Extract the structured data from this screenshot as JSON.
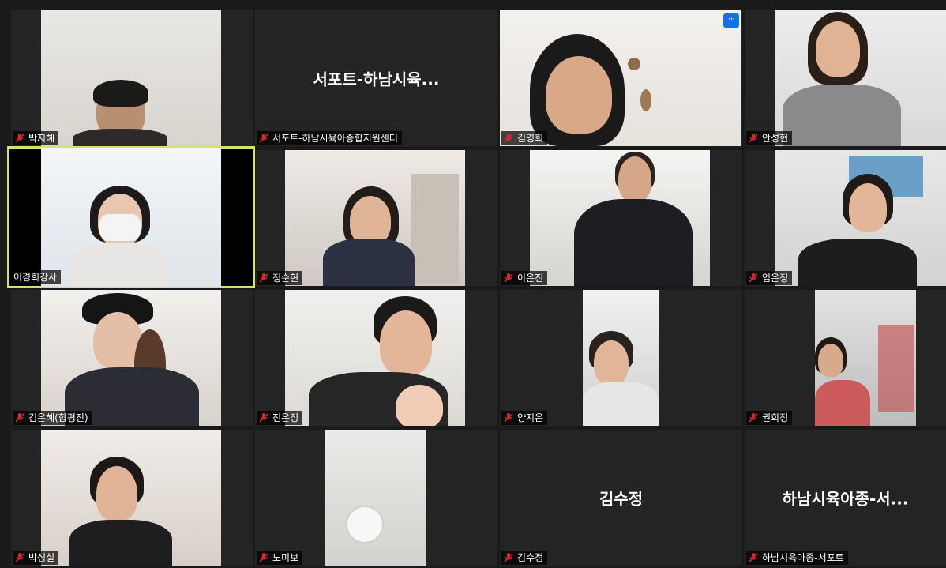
{
  "colors": {
    "background": "#1a1a1a",
    "tile": "#242424",
    "active_speaker_border": "#d6e36a",
    "muted_icon": "#e02828",
    "more_button": "#0e72ed"
  },
  "icons": {
    "muted": "microphone-muted-icon",
    "more": "more-options-icon"
  },
  "participants": [
    {
      "name": "박지혜",
      "video": true,
      "muted": true
    },
    {
      "name": "서포트-하남시육아종합지원센터",
      "display_name": "서포트-하남시육...",
      "video": false,
      "muted": true
    },
    {
      "name": "김영희",
      "video": true,
      "muted": true,
      "more_label": "···"
    },
    {
      "name": "안성현",
      "video": true,
      "muted": true
    },
    {
      "name": "이경희강사",
      "video": true,
      "muted": false,
      "active_speaker": true
    },
    {
      "name": "정순현",
      "video": true,
      "muted": true
    },
    {
      "name": "이은진",
      "video": true,
      "muted": true
    },
    {
      "name": "임은정",
      "video": true,
      "muted": true
    },
    {
      "name": "김은혜(함평진)",
      "video": true,
      "muted": true
    },
    {
      "name": "전은정",
      "video": true,
      "muted": true
    },
    {
      "name": "양지은",
      "video": true,
      "muted": true
    },
    {
      "name": "권희정",
      "video": true,
      "muted": true
    },
    {
      "name": "박성실",
      "video": true,
      "muted": true
    },
    {
      "name": "노미보",
      "video": true,
      "muted": true
    },
    {
      "name": "김수정",
      "display_name": "김수정",
      "video": false,
      "muted": true
    },
    {
      "name": "하남시육아종-서포트",
      "display_name": "하남시육아종-서...",
      "video": false,
      "muted": true
    }
  ]
}
